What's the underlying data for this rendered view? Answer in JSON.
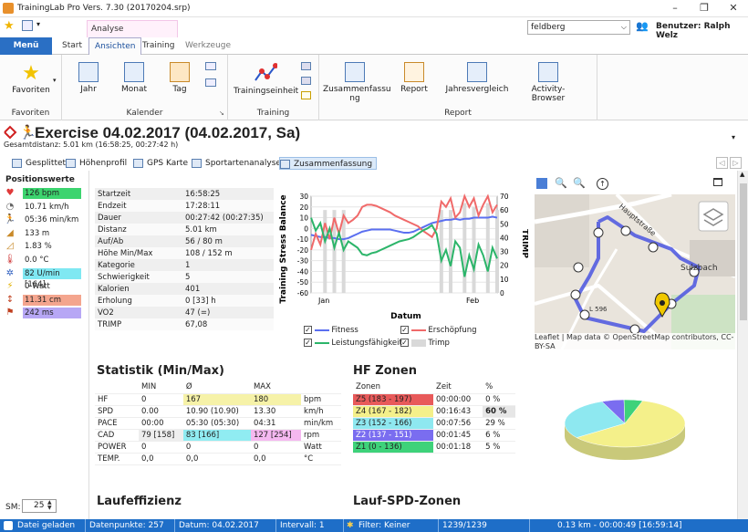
{
  "window": {
    "title": "TrainingLab Pro Vers. 7.30 (20170204.srp)",
    "min": "–",
    "max": "❐",
    "close": "✕"
  },
  "qat": {
    "user_select": "feldberg",
    "user_label": "Benutzer: Ralph Welz"
  },
  "ribbon_tabs": {
    "menu": "Menü",
    "start": "Start",
    "ansichten": "Ansichten",
    "training": "Training",
    "werkzeuge": "Werkzeuge",
    "analyse_group": "Analyse"
  },
  "ribbon": {
    "favoriten": {
      "btn": "Favoriten",
      "group": "Favoriten"
    },
    "kalender": {
      "jahr": "Jahr",
      "monat": "Monat",
      "tag": "Tag",
      "group": "Kalender"
    },
    "training": {
      "einheit": "Trainingseinheit",
      "group": "Training"
    },
    "report": {
      "zusammen": "Zusammenfassu\nng",
      "report": "Report",
      "jahres": "Jahresvergleich",
      "activity": "Activity-Browser",
      "group": "Report"
    }
  },
  "header": {
    "title": "Exercise 04.02.2017 (04.02.2017, Sa)",
    "subtitle": "Gesamtdistanz: 5.01 km (16:58:25, 00:27:42 h)"
  },
  "subtabs": [
    "Gesplittet",
    "Höhenprofil",
    "GPS Karte",
    "Sportartenanalyse",
    "Zusammenfassung"
  ],
  "left_panel": {
    "title": "Positionswerte",
    "values": [
      {
        "icon": "heart-icon",
        "text": "126 bpm",
        "bg": "#3cd46f"
      },
      {
        "icon": "speedometer-icon",
        "text": "10.71 km/h",
        "bg": ""
      },
      {
        "icon": "runner-icon",
        "text": "05:36 min/km",
        "bg": ""
      },
      {
        "icon": "mountain-icon",
        "text": "133 m",
        "bg": ""
      },
      {
        "icon": "slope-icon",
        "text": "1.83 %",
        "bg": ""
      },
      {
        "icon": "thermometer-icon",
        "text": "0.0 °C",
        "bg": ""
      },
      {
        "icon": "cadence-icon",
        "text": "82 U/min [164]",
        "bg": "#7fe8f2"
      },
      {
        "icon": "power-icon",
        "text": "0 Watt",
        "bg": ""
      },
      {
        "icon": "distance-icon",
        "text": "11.31 cm",
        "bg": "#f4a58e"
      },
      {
        "icon": "time-icon",
        "text": "242 ms",
        "bg": "#b7a7f5"
      }
    ],
    "sm_label": "SM:",
    "sm_value": "25"
  },
  "summary": [
    [
      "Startzeit",
      "16:58:25"
    ],
    [
      "Endzeit",
      "17:28:11"
    ],
    [
      "Dauer",
      "00:27:42 (00:27:35)"
    ],
    [
      "Distanz",
      "5.01 km"
    ],
    [
      "Auf/Ab",
      "56 / 80 m"
    ],
    [
      "Höhe Min/Max",
      "108 / 152 m"
    ],
    [
      "Kategorie",
      "1"
    ],
    [
      "Schwierigkeit",
      "5"
    ],
    [
      "Kalorien",
      "401"
    ],
    [
      "Erholung",
      "0 [33] h"
    ],
    [
      "VO2",
      "47 (=)"
    ],
    [
      "TRIMP",
      "67,08"
    ]
  ],
  "chart_data": {
    "type": "line",
    "xlabel": "Datum",
    "ylabel": "Training Stress Balance",
    "y2label": "TRIMP",
    "x_ticks": [
      "Jan",
      "Feb"
    ],
    "ylim": [
      -60,
      30
    ],
    "y_ticks": [
      30,
      20,
      10,
      0,
      -10,
      -20,
      -30,
      -40,
      -50,
      -60
    ],
    "y2lim": [
      0,
      70
    ],
    "y2_ticks": [
      70,
      60,
      50,
      40,
      30,
      20,
      10,
      0
    ],
    "series": [
      {
        "name": "Fitness",
        "color": "#5b6ff0",
        "values": [
          -6,
          -7,
          -8,
          -8,
          -9,
          -9,
          -10,
          -10,
          -9,
          -7,
          -5,
          -3,
          -2,
          -1,
          -1,
          -1,
          -1,
          -1,
          -2,
          -3,
          -4,
          -4,
          -3,
          -1,
          1,
          3,
          5,
          6,
          7,
          8,
          8,
          9,
          8,
          9,
          9,
          10,
          10,
          10,
          10,
          11,
          10
        ]
      },
      {
        "name": "Erschöpfung",
        "color": "#f06a6a",
        "values": [
          -20,
          -5,
          -15,
          5,
          -10,
          10,
          -5,
          12,
          5,
          8,
          12,
          20,
          22,
          22,
          21,
          19,
          17,
          15,
          12,
          10,
          8,
          6,
          4,
          2,
          -2,
          -5,
          -8,
          0,
          25,
          20,
          28,
          10,
          15,
          30,
          20,
          28,
          12,
          22,
          30,
          15,
          22
        ]
      },
      {
        "name": "Leistungsfähigkeit",
        "color": "#2cb56a",
        "values": [
          10,
          -2,
          5,
          -12,
          0,
          -18,
          -4,
          -20,
          -12,
          -15,
          -18,
          -24,
          -25,
          -23,
          -22,
          -20,
          -18,
          -16,
          -14,
          -12,
          -11,
          -10,
          -8,
          -5,
          -2,
          0,
          3,
          -5,
          -30,
          -20,
          -35,
          -12,
          -18,
          -45,
          -25,
          -38,
          -15,
          -25,
          -40,
          -18,
          -28
        ]
      },
      {
        "name": "Trimp",
        "color": "#d9d9d9",
        "values": [
          0,
          0,
          0,
          60,
          0,
          60,
          0,
          60,
          0,
          0,
          0,
          0,
          0,
          0,
          0,
          0,
          0,
          0,
          0,
          0,
          0,
          0,
          0,
          0,
          0,
          0,
          0,
          0,
          60,
          0,
          60,
          0,
          0,
          65,
          0,
          62,
          0,
          0,
          65,
          0,
          60
        ]
      }
    ],
    "legend": [
      "Fitness",
      "Erschöpfung",
      "Leistungsfähigkeit",
      "Trimp"
    ]
  },
  "map": {
    "attribution": "Leaflet | Map data © OpenStreetMap contributors, CC-BY-SA",
    "label1": "Hauptstraße",
    "label2": "Sulzbach",
    "label3": "L 596"
  },
  "statistik": {
    "title": "Statistik (Min/Max)",
    "headers": [
      "",
      "MIN",
      "Ø",
      "MAX",
      ""
    ],
    "rows": [
      [
        "HF",
        "0",
        "167",
        "180",
        "bpm"
      ],
      [
        "SPD",
        "0.00",
        "10.90 (10.90)",
        "13.30",
        "km/h"
      ],
      [
        "PACE",
        "00:00",
        "05:30 (05:30)",
        "04:31",
        "min/km"
      ],
      [
        "CAD",
        "79 [158]",
        "83 [166]",
        "127 [254]",
        "rpm"
      ],
      [
        "POWER",
        "0",
        "0",
        "0",
        "Watt"
      ],
      [
        "TEMP.",
        "0,0",
        "0,0",
        "0,0",
        "°C"
      ]
    ]
  },
  "hfzonen": {
    "title": "HF Zonen",
    "headers": [
      "Zonen",
      "Zeit",
      "%"
    ],
    "rows": [
      {
        "zone": "Z5 (183 - 197)",
        "zeit": "00:00:00",
        "pct": "0 %",
        "color": "#e85a5a",
        "value": 0
      },
      {
        "zone": "Z4 (167 - 182)",
        "zeit": "00:16:43",
        "pct": "60 %",
        "color": "#f4f08a",
        "value": 60
      },
      {
        "zone": "Z3 (152 - 166)",
        "zeit": "00:07:56",
        "pct": "29 %",
        "color": "#8ee8f0",
        "value": 29
      },
      {
        "zone": "Z2 (137 - 151)",
        "zeit": "00:01:45",
        "pct": "6 %",
        "color": "#7a6df0",
        "value": 6
      },
      {
        "zone": "Z1 (0 - 136)",
        "zeit": "00:01:18",
        "pct": "5 %",
        "color": "#3ed27a",
        "value": 5
      }
    ]
  },
  "lauf": {
    "title": "Laufeffizienz",
    "title2": "Lauf-SPD-Zonen"
  },
  "status": [
    "Datei geladen",
    "Datenpunkte: 257",
    "Datum: 04.02.2017",
    "Intervall: 1",
    "Filter: Keiner",
    "1239/1239",
    "0.13 km - 00:00:49 [16:59:14]"
  ]
}
